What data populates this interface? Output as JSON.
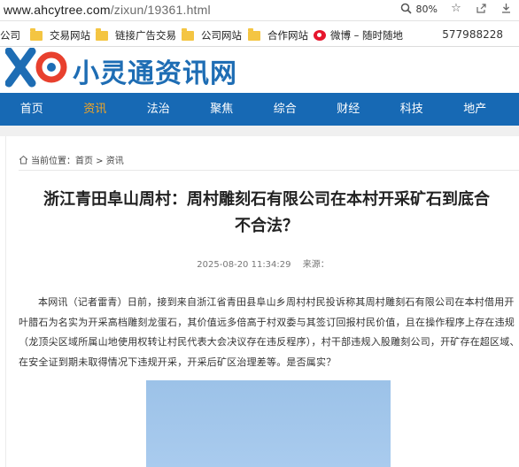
{
  "browser": {
    "url_host": "www.ahcytree.com",
    "url_path": "/zixun/19361.html",
    "zoom": "80%",
    "icons": [
      "search-icon",
      "star-icon",
      "share-icon",
      "download-icon"
    ]
  },
  "bookmarks": {
    "items": [
      {
        "label": "公司",
        "icon": "none"
      },
      {
        "label": "交易网站",
        "icon": "folder-icon"
      },
      {
        "label": "链接广告交易",
        "icon": "folder-icon"
      },
      {
        "label": "公司网站",
        "icon": "folder-icon"
      },
      {
        "label": "合作网站",
        "icon": "folder-icon"
      },
      {
        "label": "微博 – 随时随地",
        "icon": "weibo-icon"
      }
    ],
    "phone": "577988228"
  },
  "site": {
    "brand": "小灵通资讯网",
    "nav": [
      "首页",
      "资讯",
      "法治",
      "聚焦",
      "综合",
      "财经",
      "科技",
      "地产"
    ],
    "active_nav": "资讯",
    "brand_color": "#1769b4",
    "active_color": "#f5a623"
  },
  "article": {
    "breadcrumb": "当前位置：首页 > 资讯",
    "title_line1": "浙江青田阜山周村：周村雕刻石有限公司在本村开采矿石到底合",
    "title_line2": "不合法？",
    "date": "2025-08-20 11:34:29",
    "source": "来源：",
    "body": "本网讯（记者雷青）日前，接到来自浙江省青田县阜山乡周村村民投诉称其周村雕刻石有限公司在本村借用开叶腊石为名实为开采高档雕刻龙蛋石，其价值远多倍高于村双委与其签订回报村民价值，且在操作程序上存在违规（龙顶尖区域所属山地使用权转让村民代表大会决议存在违反程序），村干部违规入股雕刻公司，开矿存在超区域、在安全证到期未取得情况下违规开采，开采后矿区治理差等。是否属实？"
  }
}
